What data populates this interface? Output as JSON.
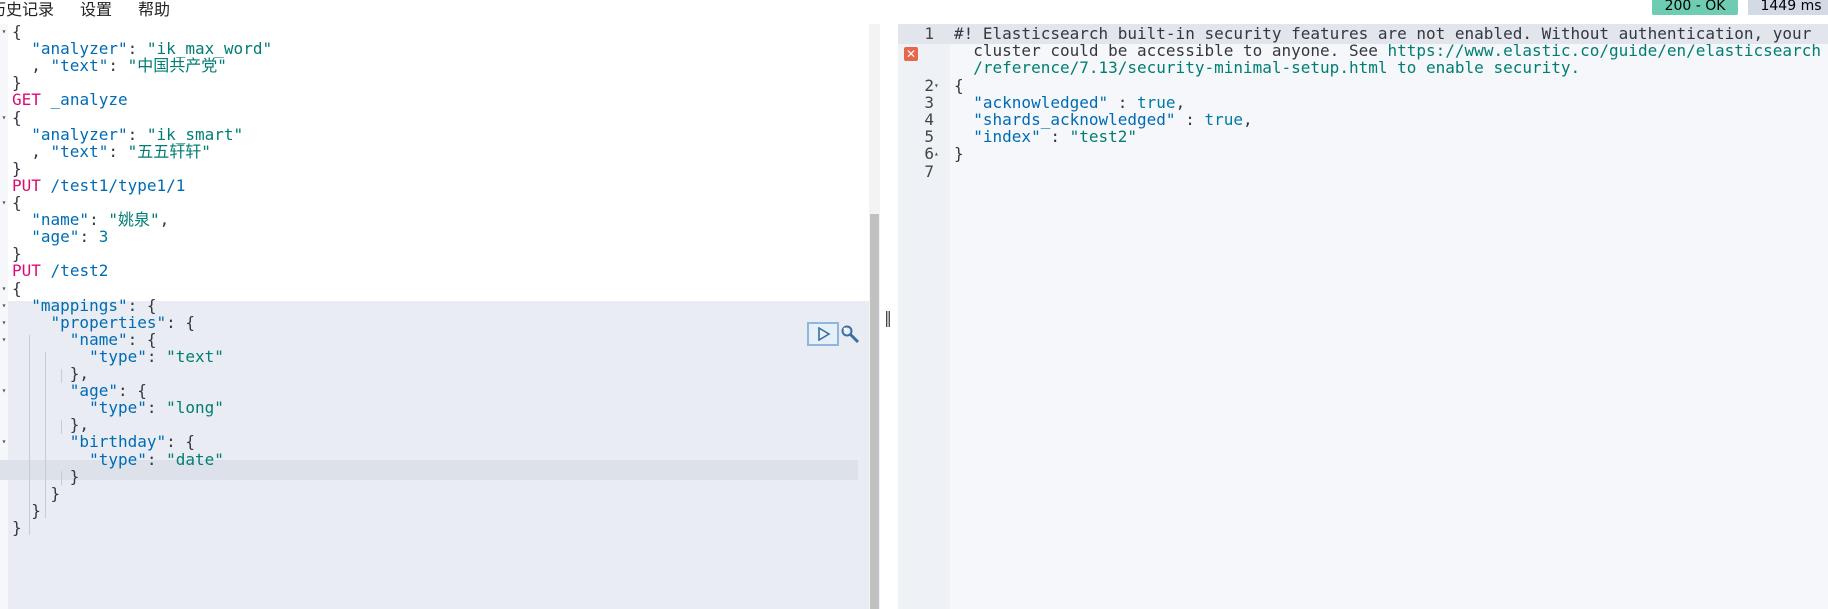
{
  "menu": {
    "history": "历史记录",
    "settings": "设置",
    "help": "帮助"
  },
  "status": {
    "code": "200 - OK",
    "time": "1449 ms"
  },
  "editor_lines": [
    [
      {
        "t": "{",
        "c": "p"
      }
    ],
    [
      {
        "t": "  ",
        "c": "p"
      },
      {
        "t": "\"analyzer\"",
        "c": "k"
      },
      {
        "t": ": ",
        "c": "p"
      },
      {
        "t": "\"ik_max_word\"",
        "c": "s"
      }
    ],
    [
      {
        "t": "  , ",
        "c": "p"
      },
      {
        "t": "\"text\"",
        "c": "k"
      },
      {
        "t": ": ",
        "c": "p"
      },
      {
        "t": "\"中国共产党\"",
        "c": "s"
      }
    ],
    [
      {
        "t": "}",
        "c": "p"
      }
    ],
    [
      {
        "t": "GET",
        "c": "m"
      },
      {
        "t": " ",
        "c": "p"
      },
      {
        "t": "_analyze",
        "c": "u"
      }
    ],
    [
      {
        "t": "{",
        "c": "p"
      }
    ],
    [
      {
        "t": "  ",
        "c": "p"
      },
      {
        "t": "\"analyzer\"",
        "c": "k"
      },
      {
        "t": ": ",
        "c": "p"
      },
      {
        "t": "\"ik_smart\"",
        "c": "s"
      }
    ],
    [
      {
        "t": "  , ",
        "c": "p"
      },
      {
        "t": "\"text\"",
        "c": "k"
      },
      {
        "t": ": ",
        "c": "p"
      },
      {
        "t": "\"五五轩轩\"",
        "c": "s"
      }
    ],
    [
      {
        "t": "}",
        "c": "p"
      }
    ],
    [
      {
        "t": "PUT",
        "c": "m"
      },
      {
        "t": " ",
        "c": "p"
      },
      {
        "t": "/test1/type1/1",
        "c": "u"
      }
    ],
    [
      {
        "t": "{",
        "c": "p"
      }
    ],
    [
      {
        "t": "  ",
        "c": "p"
      },
      {
        "t": "\"name\"",
        "c": "k"
      },
      {
        "t": ": ",
        "c": "p"
      },
      {
        "t": "\"姚泉\"",
        "c": "s"
      },
      {
        "t": ",",
        "c": "p"
      }
    ],
    [
      {
        "t": "  ",
        "c": "p"
      },
      {
        "t": "\"age\"",
        "c": "k"
      },
      {
        "t": ": ",
        "c": "p"
      },
      {
        "t": "3",
        "c": "n"
      }
    ],
    [
      {
        "t": "}",
        "c": "p"
      }
    ],
    [
      {
        "t": "PUT",
        "c": "m"
      },
      {
        "t": " ",
        "c": "p"
      },
      {
        "t": "/test2",
        "c": "u"
      }
    ],
    [
      {
        "t": "{",
        "c": "p"
      }
    ],
    [
      {
        "t": "  ",
        "c": "p"
      },
      {
        "t": "\"mappings\"",
        "c": "k"
      },
      {
        "t": ": {",
        "c": "p"
      }
    ],
    [
      {
        "t": "    ",
        "c": "p"
      },
      {
        "t": "\"properties\"",
        "c": "k"
      },
      {
        "t": ": {",
        "c": "p"
      }
    ],
    [
      {
        "t": "      ",
        "c": "p"
      },
      {
        "t": "\"name\"",
        "c": "k"
      },
      {
        "t": ": {",
        "c": "p"
      }
    ],
    [
      {
        "t": "        ",
        "c": "p"
      },
      {
        "t": "\"type\"",
        "c": "k"
      },
      {
        "t": ": ",
        "c": "p"
      },
      {
        "t": "\"text\"",
        "c": "s"
      }
    ],
    [
      {
        "t": "      },",
        "c": "p"
      }
    ],
    [
      {
        "t": "      ",
        "c": "p"
      },
      {
        "t": "\"age\"",
        "c": "k"
      },
      {
        "t": ": {",
        "c": "p"
      }
    ],
    [
      {
        "t": "        ",
        "c": "p"
      },
      {
        "t": "\"type\"",
        "c": "k"
      },
      {
        "t": ": ",
        "c": "p"
      },
      {
        "t": "\"long\"",
        "c": "s"
      }
    ],
    [
      {
        "t": "      },",
        "c": "p"
      }
    ],
    [
      {
        "t": "      ",
        "c": "p"
      },
      {
        "t": "\"birthday\"",
        "c": "k"
      },
      {
        "t": ": {",
        "c": "p"
      }
    ],
    [
      {
        "t": "        ",
        "c": "p"
      },
      {
        "t": "\"type\"",
        "c": "k"
      },
      {
        "t": ": ",
        "c": "p"
      },
      {
        "t": "\"date\"",
        "c": "s"
      }
    ],
    [
      {
        "t": "      }",
        "c": "p"
      }
    ],
    [
      {
        "t": "    }",
        "c": "p"
      }
    ],
    [
      {
        "t": "  }",
        "c": "p"
      }
    ],
    [
      {
        "t": "}",
        "c": "p"
      }
    ]
  ],
  "output_lines": [
    {
      "num": "1",
      "fold": "",
      "segs": [
        {
          "t": "#! Elasticsearch built-in security features are not enabled. Without authentication, your",
          "c": "p"
        }
      ]
    },
    {
      "num": "",
      "fold": "",
      "segs": [
        {
          "t": "  cluster could be accessible to anyone. See ",
          "c": "p"
        },
        {
          "t": "https://www.elastic.co/guide/en/elasticsearch",
          "c": "url"
        }
      ]
    },
    {
      "num": "",
      "fold": "",
      "segs": [
        {
          "t": "  /reference/7.13/security-minimal-setup.html to enable security.",
          "c": "url"
        }
      ]
    },
    {
      "num": "2",
      "fold": "▾",
      "segs": [
        {
          "t": "{",
          "c": "p"
        }
      ]
    },
    {
      "num": "3",
      "fold": "",
      "segs": [
        {
          "t": "  ",
          "c": "p"
        },
        {
          "t": "\"acknowledged\"",
          "c": "k"
        },
        {
          "t": " : ",
          "c": "p"
        },
        {
          "t": "true",
          "c": "n"
        },
        {
          "t": ",",
          "c": "p"
        }
      ]
    },
    {
      "num": "4",
      "fold": "",
      "segs": [
        {
          "t": "  ",
          "c": "p"
        },
        {
          "t": "\"shards_acknowledged\"",
          "c": "k"
        },
        {
          "t": " : ",
          "c": "p"
        },
        {
          "t": "true",
          "c": "n"
        },
        {
          "t": ",",
          "c": "p"
        }
      ]
    },
    {
      "num": "5",
      "fold": "",
      "segs": [
        {
          "t": "  ",
          "c": "p"
        },
        {
          "t": "\"index\"",
          "c": "k"
        },
        {
          "t": " : ",
          "c": "p"
        },
        {
          "t": "\"test2\"",
          "c": "s"
        }
      ]
    },
    {
      "num": "6",
      "fold": "▴",
      "segs": [
        {
          "t": "}",
          "c": "p"
        }
      ]
    },
    {
      "num": "7",
      "fold": "",
      "segs": []
    }
  ],
  "icons": {
    "run": "play-icon",
    "wrench": "wrench-icon",
    "error": "error-icon",
    "splitter": "resize-handle-icon"
  },
  "splitter_glyph": "‖"
}
